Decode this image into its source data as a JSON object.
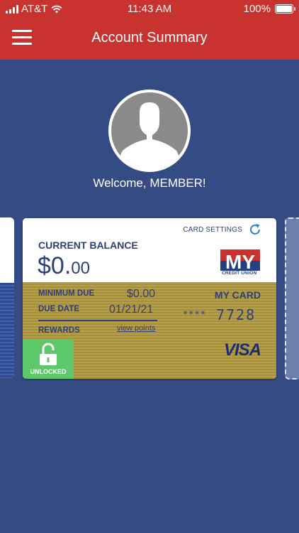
{
  "status_bar": {
    "carrier": "AT&T",
    "time": "11:43 AM",
    "battery": "100%"
  },
  "nav": {
    "title": "Account Summary"
  },
  "profile": {
    "welcome": "Welcome, MEMBER!"
  },
  "card": {
    "settings_label": "CARD SETTINGS",
    "balance_label": "CURRENT BALANCE",
    "balance_dollars": "$0.",
    "balance_cents": "00",
    "logo_text": "MY",
    "logo_sub": "CREDIT UNION",
    "min_due_label": "MINIMUM DUE",
    "min_due_value": "$0.00",
    "due_date_label": "DUE DATE",
    "due_date_value": "01/21/21",
    "rewards_label": "REWARDS",
    "view_points": "view points",
    "card_name": "MY CARD",
    "card_mask": "****",
    "card_last4": "7728",
    "network": "VISA",
    "lock_status": "UNLOCKED"
  },
  "colors": {
    "header_red": "#c8332f",
    "background_blue": "#344b83",
    "card_gold": "#b59f48",
    "unlocked_green": "#5cc86a"
  }
}
